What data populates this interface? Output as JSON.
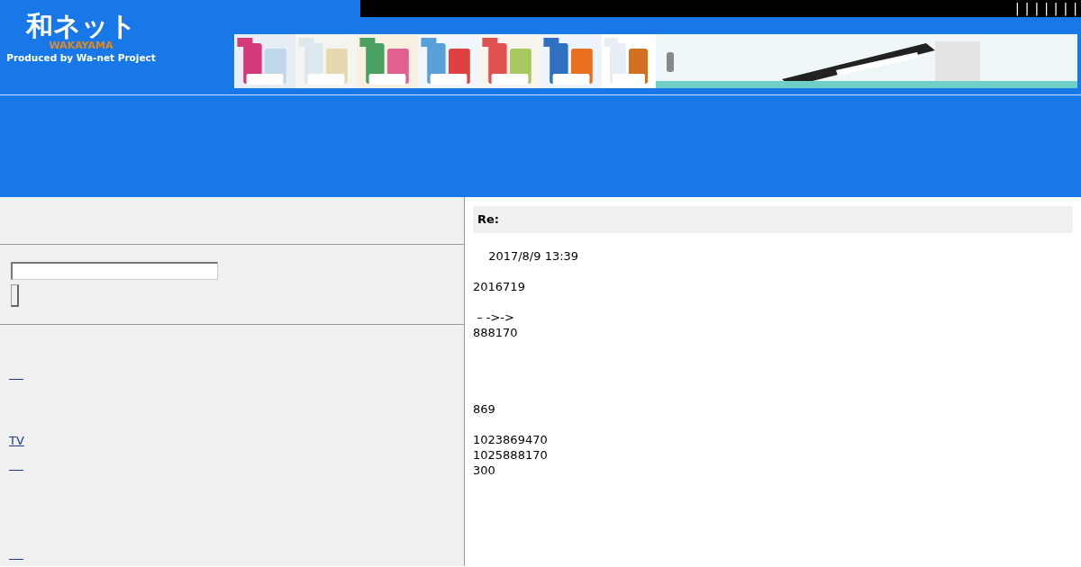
{
  "header": {
    "logo": {
      "title": "和ネット",
      "region": "WAKAYAMA",
      "credit": "Produced by Wa-net Project"
    },
    "top_links": [
      "|",
      "|",
      "|",
      "|",
      "|",
      "|",
      "|"
    ],
    "ads": [
      {
        "kind": "picture"
      },
      {
        "kind": "picture"
      },
      {
        "kind": "picture"
      },
      {
        "kind": "picture"
      },
      {
        "kind": "picture"
      },
      {
        "kind": "picture"
      },
      {
        "kind": "picture"
      },
      {
        "kind": "picture"
      }
    ]
  },
  "sidebar": {
    "links": [
      {
        "kind": "blank"
      },
      {
        "kind": "text",
        "label": "TV"
      },
      {
        "kind": "blank"
      },
      {
        "kind": "blank"
      }
    ]
  },
  "post": {
    "title": "Re:",
    "paragraphs": [
      [
        "　 2017/8/9 13:39"
      ],
      [
        "2016719"
      ],
      [
        " – ->->",
        "888170"
      ],
      [
        "869"
      ],
      [
        "1023869470",
        "1025888170",
        "300"
      ]
    ]
  }
}
